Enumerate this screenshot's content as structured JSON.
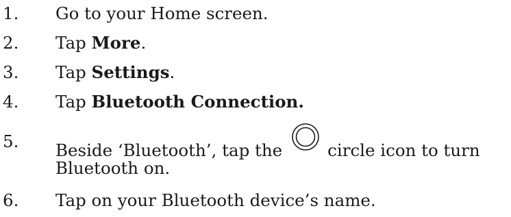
{
  "steps": [
    {
      "number": "1.",
      "text": "Go to your Home screen."
    },
    {
      "number": "2.",
      "prefix": "Tap ",
      "bold": "More",
      "suffix": "."
    },
    {
      "number": "3.",
      "prefix": "Tap ",
      "bold": "Settings",
      "suffix": "."
    },
    {
      "number": "4.",
      "prefix": "Tap ",
      "bold": "Bluetooth Connection."
    },
    {
      "number": "5.",
      "before_icon": "Beside ‘Bluetooth’, tap the",
      "after_icon": "circle icon to turn",
      "line2": "Bluetooth on.",
      "icon": "circle-icon"
    },
    {
      "number": "6.",
      "text": "Tap on your Bluetooth device’s name."
    }
  ]
}
